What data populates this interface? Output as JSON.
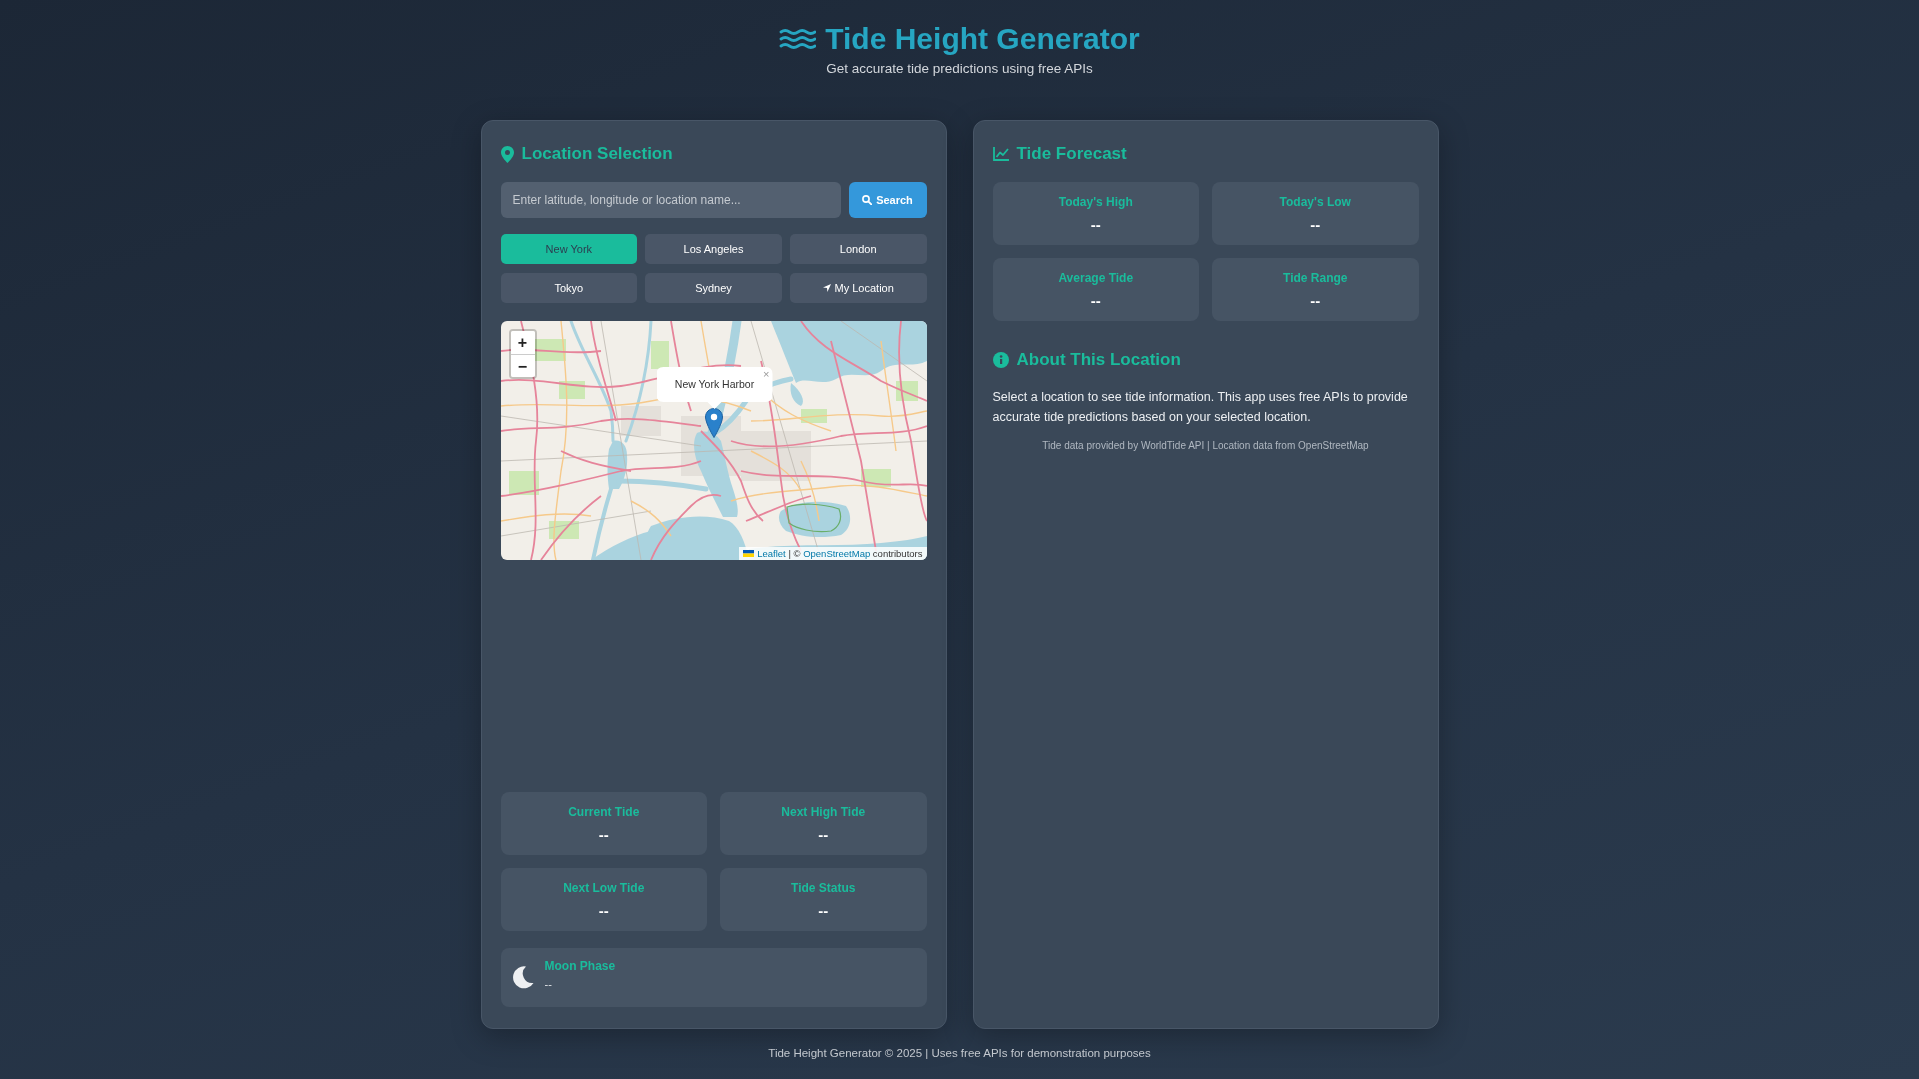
{
  "header": {
    "title": "Tide Height Generator",
    "subtitle": "Get accurate tide predictions using free APIs"
  },
  "location_panel": {
    "heading": "Location Selection",
    "search": {
      "placeholder": "Enter latitude, longitude or location name...",
      "button": "Search"
    },
    "locations": [
      {
        "label": "New York",
        "kind": "city",
        "selected": true
      },
      {
        "label": "Los Angeles",
        "kind": "city",
        "selected": false
      },
      {
        "label": "London",
        "kind": "city",
        "selected": false
      },
      {
        "label": "Tokyo",
        "kind": "city",
        "selected": false
      },
      {
        "label": "Sydney",
        "kind": "city",
        "selected": false
      },
      {
        "label": "My Location",
        "kind": "locate",
        "selected": false
      }
    ],
    "map": {
      "zoom_in": "+",
      "zoom_out": "−",
      "popup": {
        "label": "New York Harbor",
        "close": "×"
      },
      "attribution": {
        "leaflet_link": "Leaflet",
        "separator": "| ©",
        "osm_link": "OpenStreetMap",
        "suffix": "contributors"
      }
    },
    "stats": [
      {
        "label": "Current Tide",
        "value": "--"
      },
      {
        "label": "Next High Tide",
        "value": "--"
      },
      {
        "label": "Next Low Tide",
        "value": "--"
      },
      {
        "label": "Tide Status",
        "value": "--"
      }
    ],
    "moon_phase": {
      "label": "Moon Phase",
      "value": "--"
    }
  },
  "forecast_panel": {
    "heading": "Tide Forecast",
    "stats": [
      {
        "label": "Today's High",
        "value": "--"
      },
      {
        "label": "Today's Low",
        "value": "--"
      },
      {
        "label": "Average Tide",
        "value": "--"
      },
      {
        "label": "Tide Range",
        "value": "--"
      }
    ],
    "about": {
      "heading": "About This Location",
      "text": "Select a location to see tide information. This app uses free APIs to provide accurate tide predictions based on your selected location.",
      "credits": "Tide data provided by WorldTide API | Location data from OpenStreetMap"
    }
  },
  "footer": "Tide Height Generator © 2025 | Uses free APIs for demonstration purposes"
}
